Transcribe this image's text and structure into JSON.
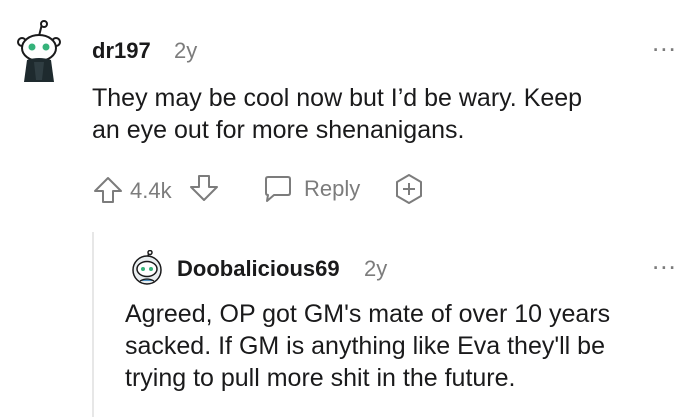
{
  "comments": [
    {
      "username": "dr197",
      "age": "2y",
      "body_lines": [
        "They may be cool now but I’d be wary. Keep",
        "an eye out for more shenanigans."
      ],
      "score": "4.4k",
      "reply_label": "Reply",
      "more_label": "..."
    },
    {
      "username": "Doobalicious69",
      "age": "2y",
      "body_lines": [
        "Agreed, OP got GM's mate of over 10 years",
        "sacked. If GM is anything like Eva they'll be",
        "trying to pull more shit in the future."
      ],
      "more_label": "..."
    }
  ],
  "colors": {
    "text": "#1a1a1b",
    "meta": "#7c7c7c",
    "thread_line": "#e7e7e7"
  },
  "icons": [
    "snoo-avatar-icon",
    "upvote-icon",
    "downvote-icon",
    "reply-bubble-icon",
    "award-plus-icon",
    "more-options-icon"
  ]
}
